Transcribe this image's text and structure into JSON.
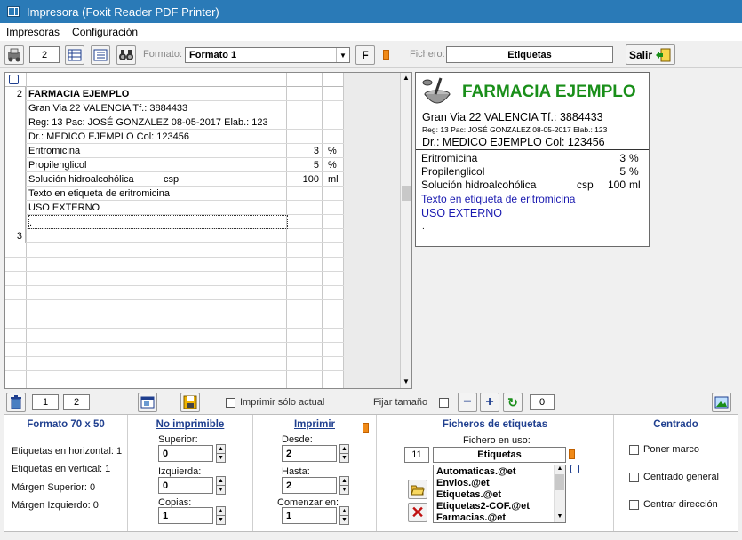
{
  "window": {
    "title": "Impresora (Foxit Reader PDF Printer)"
  },
  "menu": {
    "items": [
      "Impresoras",
      "Configuración"
    ]
  },
  "toolbar": {
    "copies_value": "2",
    "format_label": "Formato:",
    "format_value": "Formato 1",
    "f_button": "F",
    "file_label": "Fichero:",
    "file_value": "Etiquetas",
    "exit_label": "Salir"
  },
  "grid": {
    "rows": [
      {
        "num": "2",
        "text": "FARMACIA EJEMPLO",
        "bold": true
      },
      {
        "num": "",
        "text": "Gran Via 22  VALENCIA  Tf.: 3884433"
      },
      {
        "num": "",
        "text": "Reg: 13 Pac: JOSÉ GONZALEZ 08-05-2017 Elab.: 123"
      },
      {
        "num": "",
        "text": "Dr.: MEDICO EJEMPLO Col: 123456"
      },
      {
        "num": "",
        "text": "Eritromicina",
        "qty": "3",
        "unit": "%"
      },
      {
        "num": "",
        "text": "Propilenglicol",
        "qty": "5",
        "unit": "%"
      },
      {
        "num": "",
        "text": "Solución hidroalcohólica",
        "csp": "csp",
        "qty": "100",
        "unit": "ml"
      },
      {
        "num": "",
        "text": "Texto en etiqueta de eritromicina"
      },
      {
        "num": "",
        "text": "USO EXTERNO"
      },
      {
        "num": "",
        "text": "."
      },
      {
        "num": "3",
        "text": ""
      }
    ]
  },
  "preview": {
    "title": "FARMACIA EJEMPLO",
    "address": "Gran Via 22  VALENCIA  Tf.: 3884433",
    "reg": "Reg: 13 Pac: JOSÉ GONZALEZ 08-05-2017 Elab.: 123",
    "doctor": "Dr.: MEDICO EJEMPLO Col: 123456",
    "items": [
      {
        "name": "Eritromicina",
        "csp": "",
        "qty": "3",
        "unit": "%"
      },
      {
        "name": "Propilenglicol",
        "csp": "",
        "qty": "5",
        "unit": "%"
      },
      {
        "name": "Solución hidroalcohólica",
        "csp": "csp",
        "qty": "100",
        "unit": "ml"
      }
    ],
    "note": "Texto en etiqueta de eritromicina",
    "usage": "USO EXTERNO",
    "dot": "."
  },
  "bottombar": {
    "page_from": "1",
    "page_to": "2",
    "print_current_label": "Imprimir sólo actual",
    "fix_size_label": "Fijar tamaño",
    "size_value": "0"
  },
  "panels": {
    "format": {
      "title": "Formato 70 x 50",
      "lines": [
        "Etiquetas en horizontal: 1",
        "Etiquetas en vertical: 1",
        "Márgen Superior: 0",
        "Márgen  Izquierdo: 0"
      ]
    },
    "nonprint": {
      "title": "No imprimible",
      "superior_label": "Superior:",
      "superior_value": "0",
      "izquierda_label": "Izquierda:",
      "izquierda_value": "0",
      "copias_label": "Copias:",
      "copias_value": "1"
    },
    "print": {
      "title": "Imprimir",
      "desde_label": "Desde:",
      "desde_value": "2",
      "hasta_label": "Hasta:",
      "hasta_value": "2",
      "comenzar_label": "Comenzar en:",
      "comenzar_value": "1"
    },
    "files": {
      "title": "Ficheros de etiquetas",
      "in_use_label": "Fichero en uso:",
      "count": "11",
      "current": "Etiquetas",
      "list": [
        "Automaticas.@et",
        "Envios.@et",
        "Etiquetas.@et",
        "Etiquetas2-COF.@et",
        "Farmacias.@et"
      ]
    },
    "center": {
      "title": "Centrado",
      "options": [
        "Poner marco",
        "Centrado general",
        "Centrar dirección"
      ]
    }
  },
  "colors": {
    "titlebar": "#2a7ab7",
    "pharmacy_green": "#1a8f1a",
    "link_blue": "#1a1ab0",
    "accent_orange": "#f08a18"
  }
}
